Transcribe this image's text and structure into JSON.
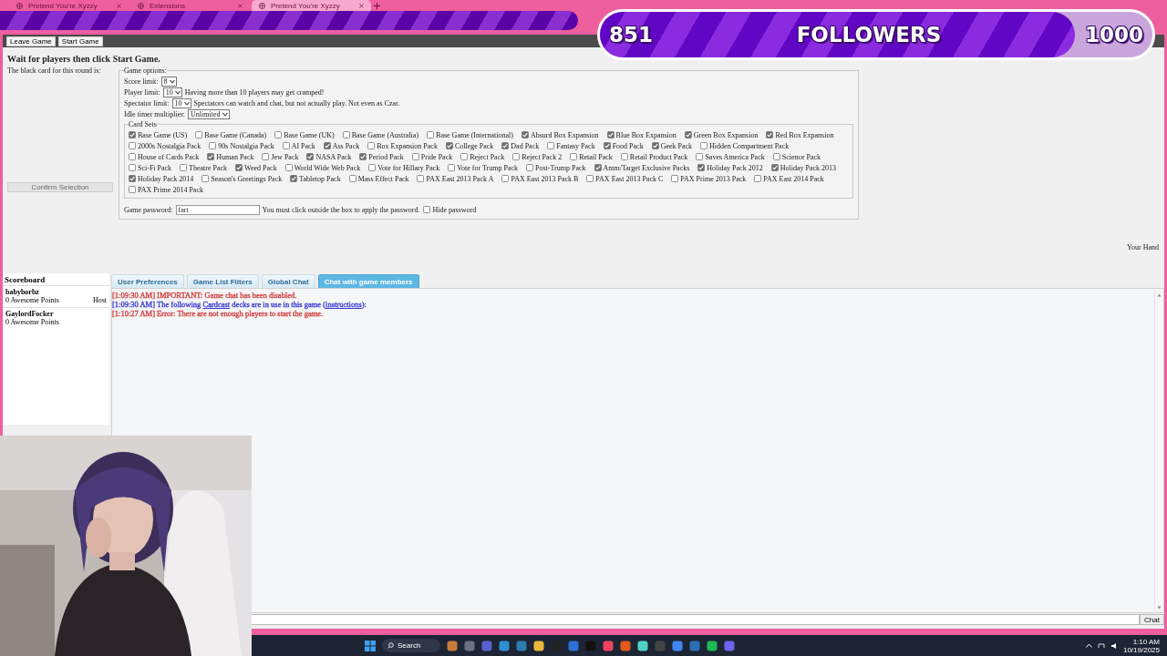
{
  "browser_tabs": [
    {
      "title": "Pretend You're Xyzzy",
      "selected": false
    },
    {
      "title": "Extensions",
      "selected": false
    },
    {
      "title": "Pretend You're Xyzzy",
      "selected": true
    }
  ],
  "stream_overlay": {
    "count": "851",
    "label": "FOLLOWERS",
    "goal": "1000",
    "level": 0.86
  },
  "game": {
    "top_buttons": [
      "Leave Game",
      "Start Game"
    ],
    "instruction": "Wait for players then click Start Game.",
    "black_card_label": "The black card for this round is:",
    "confirm_button": {
      "label": "Confirm Selection",
      "disabled": true
    },
    "options": {
      "legend": "Game options:",
      "fields": [
        {
          "label": "Score limit:",
          "value": "8"
        },
        {
          "label": "Player limit:",
          "value": "10",
          "note": "Having more than 10 players may get cramped!"
        },
        {
          "label": "Spectator limit:",
          "value": "10",
          "note": "Spectators can watch and chat, but not actually play. Not even as Czar."
        },
        {
          "label": "Idle timer multiplier:",
          "value": "Unlimited"
        }
      ],
      "card_sets_legend": "Card Sets",
      "card_sets": [
        {
          "name": "Base Game (US)",
          "checked": true
        },
        {
          "name": "Base Game (Canada)",
          "checked": false
        },
        {
          "name": "Base Game (UK)",
          "checked": false
        },
        {
          "name": "Base Game (Australia)",
          "checked": false
        },
        {
          "name": "Base Game (International)",
          "checked": false
        },
        {
          "name": "Absurd Box Expansion",
          "checked": true
        },
        {
          "name": "Blue Box Expansion",
          "checked": true
        },
        {
          "name": "Green Box Expansion",
          "checked": true
        },
        {
          "name": "Red Box Expansion",
          "checked": true
        },
        {
          "name": "2000s Nostalgia Pack",
          "checked": false
        },
        {
          "name": "90s Nostalgia Pack",
          "checked": false
        },
        {
          "name": "AI Pack",
          "checked": false
        },
        {
          "name": "Ass Pack",
          "checked": true
        },
        {
          "name": "Box Expansion Pack",
          "checked": false
        },
        {
          "name": "College Pack",
          "checked": true
        },
        {
          "name": "Dad Pack",
          "checked": true
        },
        {
          "name": "Fantasy Pack",
          "checked": false
        },
        {
          "name": "Food Pack",
          "checked": true
        },
        {
          "name": "Geek Pack",
          "checked": true
        },
        {
          "name": "Hidden Compartment Pack",
          "checked": false
        },
        {
          "name": "House of Cards Pack",
          "checked": false
        },
        {
          "name": "Human Pack",
          "checked": true
        },
        {
          "name": "Jew Pack",
          "checked": false
        },
        {
          "name": "NASA Pack",
          "checked": true
        },
        {
          "name": "Period Pack",
          "checked": true
        },
        {
          "name": "Pride Pack",
          "checked": false
        },
        {
          "name": "Reject Pack",
          "checked": false
        },
        {
          "name": "Reject Pack 2",
          "checked": false
        },
        {
          "name": "Retail Pack",
          "checked": false
        },
        {
          "name": "Retail Product Pack",
          "checked": false
        },
        {
          "name": "Saves America Pack",
          "checked": false
        },
        {
          "name": "Science Pack",
          "checked": false
        },
        {
          "name": "Sci-Fi Pack",
          "checked": false
        },
        {
          "name": "Theatre Pack",
          "checked": false
        },
        {
          "name": "Weed Pack",
          "checked": true
        },
        {
          "name": "World Wide Web Pack",
          "checked": false
        },
        {
          "name": "Vote for Hillary Pack",
          "checked": false
        },
        {
          "name": "Vote for Trump Pack",
          "checked": false
        },
        {
          "name": "Post-Trump Pack",
          "checked": false
        },
        {
          "name": "Amm/Target Exclusive Packs",
          "checked": true
        },
        {
          "name": "Holiday Pack 2012",
          "checked": true
        },
        {
          "name": "Holiday Pack 2013",
          "checked": true
        },
        {
          "name": "Holiday Pack 2014",
          "checked": true
        },
        {
          "name": "Season's Greetings Pack",
          "checked": false
        },
        {
          "name": "Tabletop Pack",
          "checked": true
        },
        {
          "name": "Mass Effect Pack",
          "checked": false
        },
        {
          "name": "PAX East 2013 Pack A",
          "checked": false
        },
        {
          "name": "PAX East 2013 Pack B",
          "checked": false
        },
        {
          "name": "PAX East 2013 Pack C",
          "checked": false
        },
        {
          "name": "PAX Prime 2013 Pack",
          "checked": false
        },
        {
          "name": "PAX East 2014 Pack",
          "checked": false
        },
        {
          "name": "PAX Prime 2014 Pack",
          "checked": false
        }
      ],
      "password": {
        "label": "Game password:",
        "value": "fart",
        "note": "You must click outside the box to apply the password.",
        "hide_label": "Hide password",
        "hide_checked": false
      }
    },
    "your_hand": "Your Hand"
  },
  "scoreboard": {
    "title": "Scoreboard",
    "players": [
      {
        "name": "babyborbz",
        "points": "0 Awesome Points",
        "role": "Host"
      },
      {
        "name": "GaylordFocker",
        "points": "0 Awesome Points"
      }
    ]
  },
  "chat": {
    "tabs": [
      {
        "label": "User Preferences",
        "selected": false
      },
      {
        "label": "Game List Filters",
        "selected": false
      },
      {
        "label": "Global Chat",
        "selected": false
      },
      {
        "label": "Chat with game members",
        "selected": true
      }
    ],
    "messages": [
      {
        "color": "#d43c3c",
        "parts": [
          "[1:09:30 AM] IMPORTANT: Game chat has been disabled."
        ]
      },
      {
        "color": "#3a3ad0",
        "parts": [
          "[1:09:30 AM] The following ",
          {
            "link": "Cardcast"
          },
          " decks are in use in this game (",
          {
            "link": "instructions"
          },
          "):"
        ]
      },
      {
        "color": "#d43c3c",
        "parts": [
          "[1:10:27 AM] Error: There are not enough players to start the game."
        ]
      }
    ],
    "send_button": "Chat"
  },
  "taskbar": {
    "search": "Search",
    "time": "1:10 AM",
    "date": "10/19/2025"
  }
}
